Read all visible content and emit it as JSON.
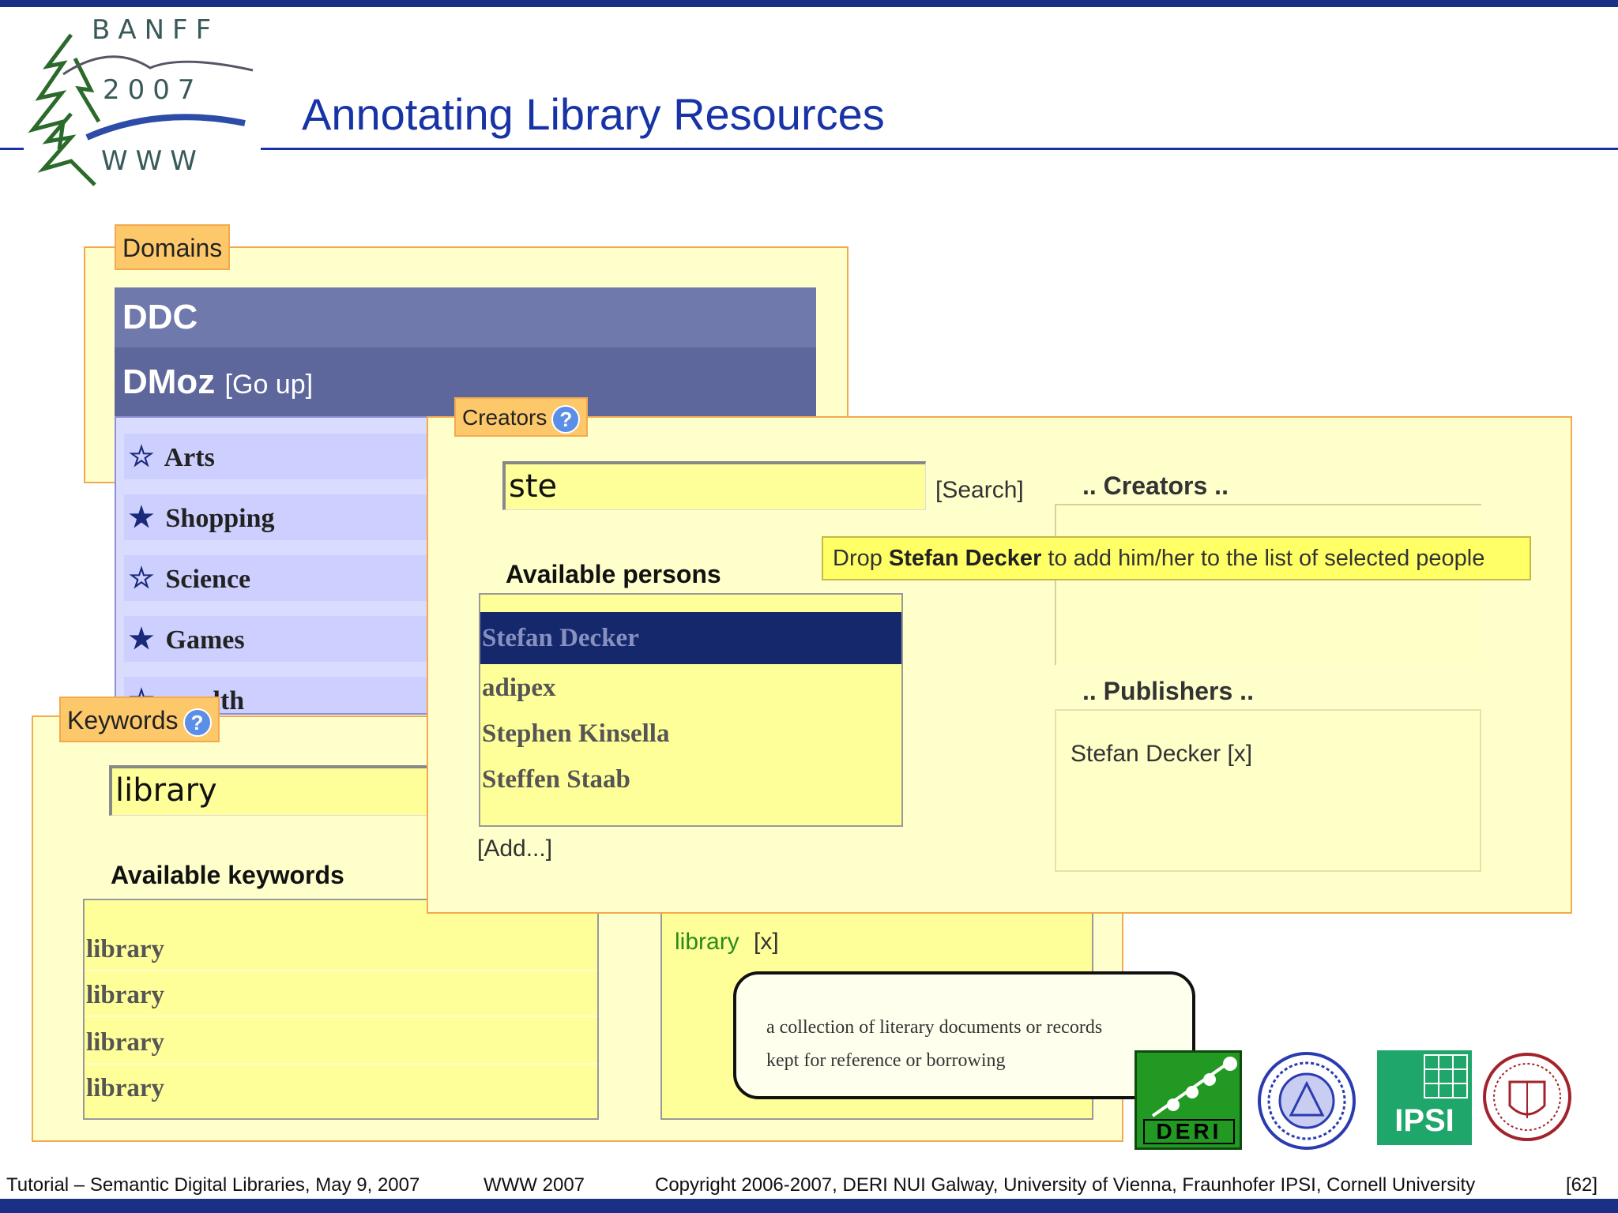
{
  "slide": {
    "title": "Annotating Library Resources",
    "logo": {
      "banff": "BANFF",
      "year": "2007",
      "www": "WWW"
    },
    "accent_color": "#1733a6",
    "panel_color": "#ffffcc",
    "border_color": "#f3a94e"
  },
  "domains": {
    "legend": "Domains",
    "header_ddc": "DDC",
    "header_dmoz": "DMoz",
    "go_up": "[Go up]",
    "items": [
      {
        "label": "Arts",
        "icon": "star-outline-icon",
        "star": "☆"
      },
      {
        "label": "Shopping",
        "icon": "star-filled-icon",
        "star": "★"
      },
      {
        "label": "Science",
        "icon": "star-outline-icon",
        "star": "☆"
      },
      {
        "label": "Games",
        "icon": "star-filled-icon",
        "star": "★"
      },
      {
        "label": "lth",
        "icon": "star-outline-icon",
        "star": "☆"
      }
    ]
  },
  "keywords": {
    "legend": "Keywords",
    "help_icon": "?",
    "input_value": "library",
    "available_label": "Available keywords",
    "available": [
      "library",
      "library",
      "library",
      "library"
    ],
    "selected": [
      {
        "label": "library",
        "remove": "[x]"
      }
    ]
  },
  "creators": {
    "legend": "Creators",
    "help_icon": "?",
    "search_value": "ste",
    "search_link": "[Search]",
    "available_label": "Available persons",
    "persons": [
      "Stefan Decker",
      "adipex",
      "Stephen Kinsella",
      "Steffen Staab"
    ],
    "add_link": "[Add...]",
    "creators_label": ".. Creators ..",
    "publishers_label": ".. Publishers ..",
    "publishers": [
      {
        "name": "Stefan Decker",
        "remove": "[x]"
      }
    ],
    "drop_hint_prefix": "Drop ",
    "drop_hint_name": "Stefan Decker",
    "drop_hint_suffix": " to add him/her to the list of selected people"
  },
  "definition_tooltip": {
    "line1": "a collection of literary documents or records",
    "line2": "kept for reference or borrowing"
  },
  "partner_logos": {
    "deri": "DERI",
    "ipsi": "IPSI"
  },
  "footer": {
    "tutorial": "Tutorial – Semantic Digital Libraries, May 9, 2007",
    "event": "WWW 2007",
    "copyright": "Copyright 2006-2007, DERI NUI Galway, University of Vienna, Fraunhofer IPSI, Cornell University",
    "page": "[62]"
  }
}
